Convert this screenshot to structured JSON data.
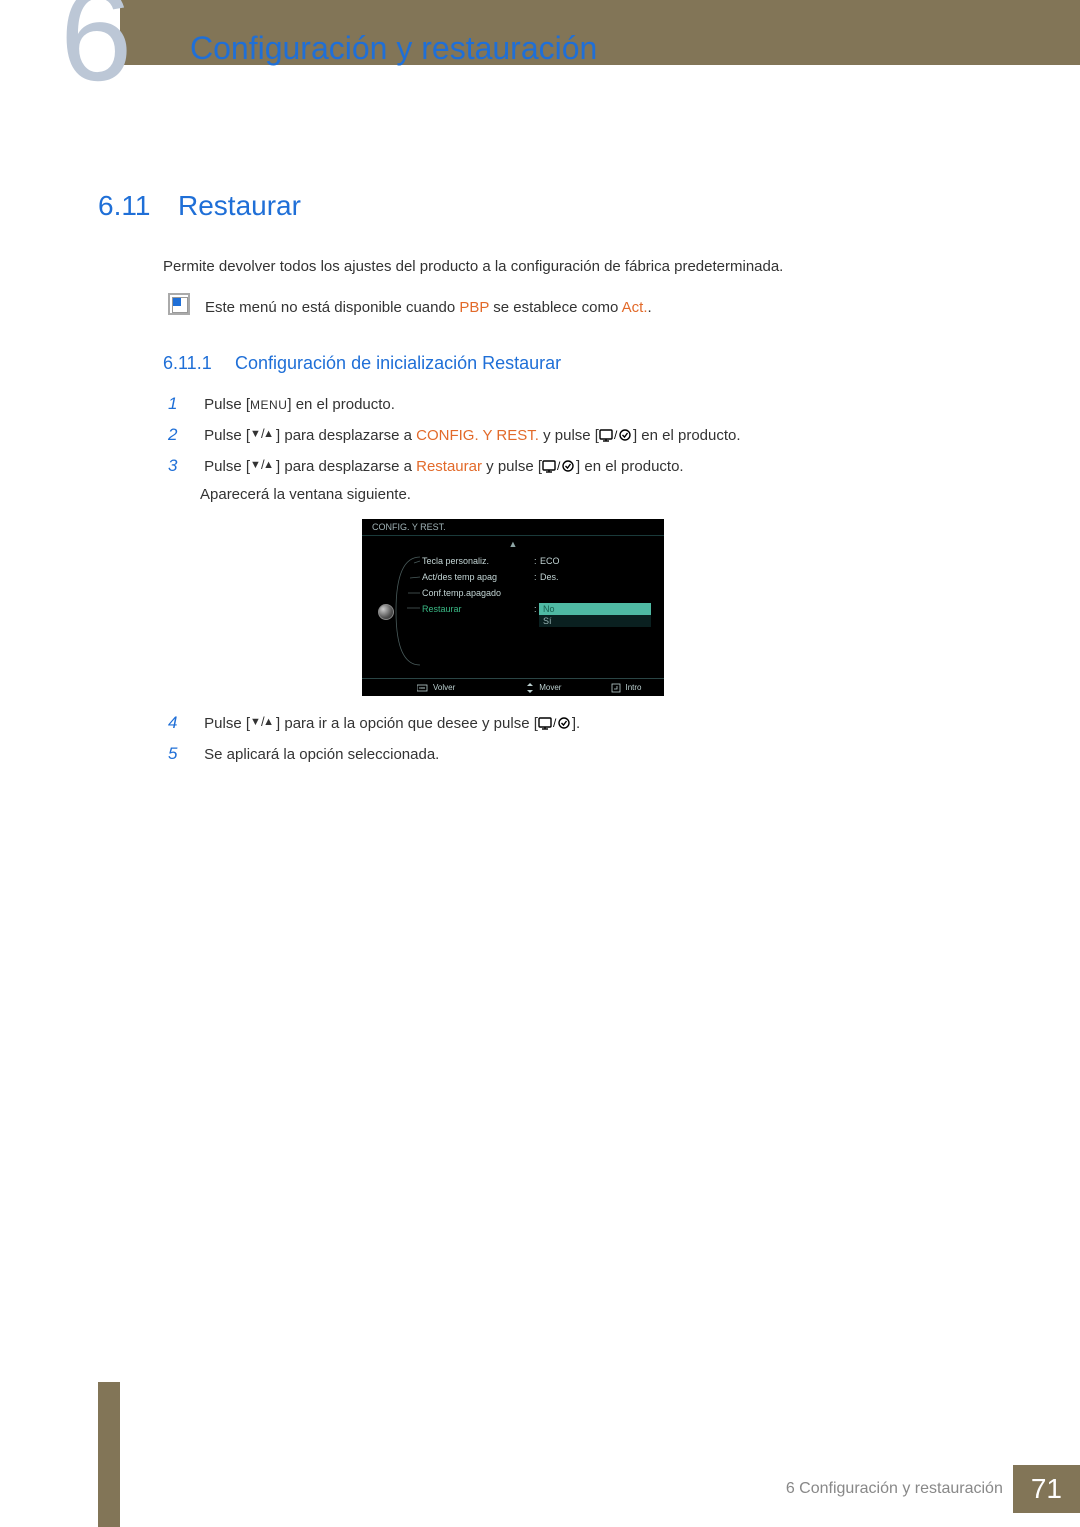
{
  "header": {
    "chapter_number": "6",
    "chapter_title": "Configuración y restauración"
  },
  "section": {
    "number": "6.11",
    "title": "Restaurar",
    "intro": "Permite devolver todos los ajustes del producto a la configuración de fábrica predeterminada.",
    "note_prefix": "Este menú no está disponible cuando ",
    "note_pbp": "PBP",
    "note_mid": " se establece como ",
    "note_act": "Act.",
    "note_suffix": "."
  },
  "subsection": {
    "number": "6.11.1",
    "title": "Configuración de inicialización Restaurar"
  },
  "steps": {
    "n1": "1",
    "n2": "2",
    "n3": "3",
    "n4": "4",
    "n5": "5",
    "s1_a": "Pulse [",
    "s1_menu": "MENU",
    "s1_b": "] en el producto.",
    "s2_a": "Pulse [",
    "s2_b": "] para desplazarse a ",
    "s2_target": "CONFIG. Y REST.",
    "s2_c": " y pulse [",
    "s2_d": "] en el producto.",
    "s3_a": "Pulse [",
    "s3_b": "] para desplazarse a ",
    "s3_target": "Restaurar",
    "s3_c": " y pulse [",
    "s3_d": "] en el producto.",
    "s3_e": "Aparecerá la ventana siguiente.",
    "s4_a": "Pulse [",
    "s4_b": "] para ir a la opción que desee y pulse [",
    "s4_c": "].",
    "s5": "Se aplicará la opción seleccionada."
  },
  "osd": {
    "title": "CONFIG. Y REST.",
    "rows": {
      "r1_label": "Tecla personaliz.",
      "r1_value": "ECO",
      "r2_label": "Act/des temp apag",
      "r2_value": "Des.",
      "r3_label": "Conf.temp.apagado",
      "r4_label": "Restaurar",
      "opt_no": "No",
      "opt_si": "Sí"
    },
    "footer": {
      "volver": "Volver",
      "mover": "Mover",
      "intro": "Intro"
    }
  },
  "footer": {
    "chapter_ref": "6 Configuración y restauración",
    "page": "71"
  }
}
